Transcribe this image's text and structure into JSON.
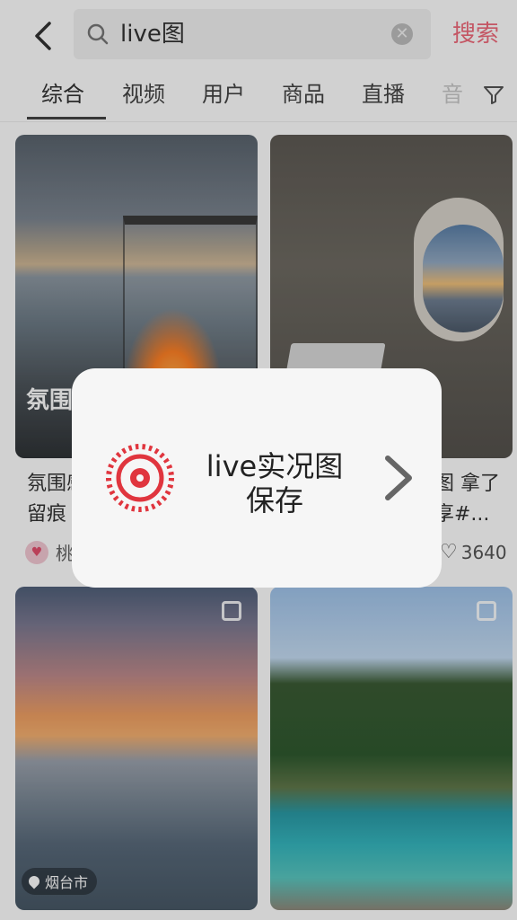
{
  "topbar": {
    "query": "live图",
    "search_button": "搜索"
  },
  "tabs": [
    "综合",
    "视频",
    "用户",
    "商品",
    "直播",
    "音"
  ],
  "cards": [
    {
      "caption": "氛围",
      "title": "氛围感\n留痕",
      "author": "桃"
    },
    {
      "title": "图 拿了\n享#...",
      "likes": "3640"
    },
    {
      "location": "烟台市"
    },
    {}
  ],
  "popup": {
    "text": "live实况图\n保存"
  },
  "colors": {
    "accent": "#f06a7a",
    "live_icon": "#e0353e"
  }
}
